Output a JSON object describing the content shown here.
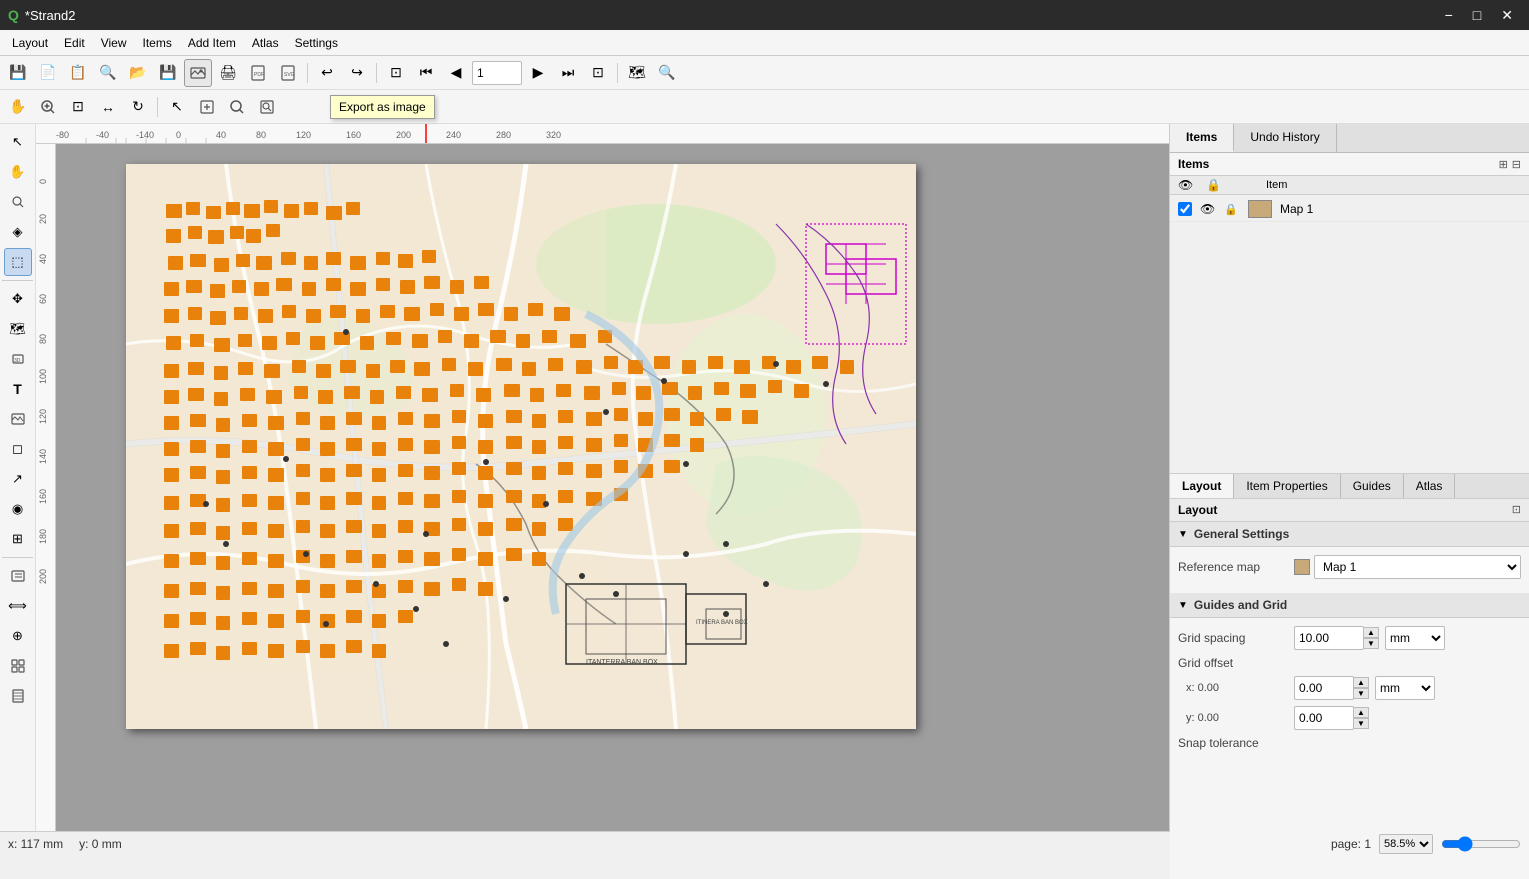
{
  "app": {
    "title": "*Strand2",
    "logo": "Q"
  },
  "titlebar": {
    "minimize": "−",
    "maximize": "□",
    "close": "✕"
  },
  "menubar": {
    "items": [
      "Layout",
      "Edit",
      "View",
      "Items",
      "Add Item",
      "Atlas",
      "Settings"
    ]
  },
  "toolbar1": {
    "buttons": [
      {
        "name": "save",
        "icon": "💾",
        "title": "Save"
      },
      {
        "name": "new",
        "icon": "📄",
        "title": "New"
      },
      {
        "name": "open-templates",
        "icon": "📋",
        "title": "Open Templates"
      },
      {
        "name": "duplicate",
        "icon": "🔍",
        "title": "Duplicate"
      },
      {
        "name": "open",
        "icon": "📂",
        "title": "Open"
      },
      {
        "name": "save2",
        "icon": "💾",
        "title": "Save"
      },
      {
        "name": "export-img",
        "icon": "🖼",
        "title": "Export as image"
      },
      {
        "name": "print",
        "icon": "🖨",
        "title": "Print"
      },
      {
        "name": "export-pdf",
        "icon": "📄",
        "title": "Export PDF"
      },
      {
        "name": "export-svg",
        "icon": "📐",
        "title": "Export SVG"
      },
      {
        "name": "undo",
        "icon": "↩",
        "title": "Undo"
      },
      {
        "name": "redo",
        "icon": "↪",
        "title": "Redo"
      }
    ],
    "page_input": "1",
    "nav_buttons": [
      "prev-page",
      "first-page",
      "prev",
      "next",
      "last-page",
      "next-page"
    ],
    "atlas_btn": "🗺",
    "zoom_btn": "🔍"
  },
  "toolbar2": {
    "buttons": [
      {
        "name": "pan",
        "icon": "✋",
        "title": "Pan"
      },
      {
        "name": "zoom-in",
        "icon": "🔍",
        "title": "Zoom In"
      },
      {
        "name": "zoom-full",
        "icon": "⊡",
        "title": "Zoom Full"
      },
      {
        "name": "zoom-width",
        "icon": "↔",
        "title": "Zoom Width"
      },
      {
        "name": "refresh",
        "icon": "↻",
        "title": "Refresh"
      },
      {
        "name": "select",
        "icon": "↖",
        "title": "Select"
      },
      {
        "name": "move-content",
        "icon": "⊕",
        "title": "Move Content"
      },
      {
        "name": "zoom-canvas",
        "icon": "🔎",
        "title": "Zoom Canvas"
      },
      {
        "name": "zoom-page",
        "icon": "🔎",
        "title": "Zoom Page"
      }
    ]
  },
  "tooltip": {
    "text": "Export as image"
  },
  "left_toolbar": {
    "buttons": [
      {
        "name": "select-tool",
        "icon": "↖",
        "active": false
      },
      {
        "name": "pan-tool",
        "icon": "✋",
        "active": false
      },
      {
        "name": "zoom-tool",
        "icon": "🔍",
        "active": false
      },
      {
        "name": "edit-nodes",
        "icon": "◈",
        "active": false
      },
      {
        "name": "select-area",
        "icon": "⬚",
        "active": true
      },
      {
        "name": "move-item",
        "icon": "✥",
        "active": false
      },
      {
        "name": "add-map",
        "icon": "🗺",
        "active": false
      },
      {
        "name": "add-label",
        "icon": "T",
        "active": false
      },
      {
        "name": "add-image",
        "icon": "🖼",
        "active": false
      },
      {
        "name": "add-shape",
        "icon": "◻",
        "active": false
      },
      {
        "name": "add-arrow",
        "icon": "↗",
        "active": false
      },
      {
        "name": "add-node",
        "icon": "◉",
        "active": false
      },
      {
        "name": "add-html",
        "icon": "⊞",
        "active": false
      },
      {
        "name": "add-legend",
        "icon": "≡",
        "active": false
      },
      {
        "name": "add-scalebar",
        "icon": "⟺",
        "active": false
      },
      {
        "name": "add-north",
        "icon": "⊕",
        "active": false
      },
      {
        "name": "group",
        "icon": "⊡",
        "active": false
      },
      {
        "name": "atlas-tool",
        "icon": "🗺",
        "active": false
      }
    ]
  },
  "right_panel": {
    "top_tabs": [
      {
        "id": "items",
        "label": "Items",
        "active": true
      },
      {
        "id": "undo-history",
        "label": "Undo History",
        "active": false
      }
    ],
    "items_header": "Items",
    "items_columns": {
      "eye": "👁",
      "lock": "🔒",
      "item": "Item"
    },
    "items_list": [
      {
        "id": "map1",
        "checked": true,
        "visible": true,
        "locked": false,
        "name": "Map 1",
        "has_thumb": true
      }
    ]
  },
  "bottom_tabs": [
    {
      "id": "layout",
      "label": "Layout",
      "active": true
    },
    {
      "id": "item-properties",
      "label": "Item Properties",
      "active": false
    },
    {
      "id": "guides",
      "label": "Guides",
      "active": false
    },
    {
      "id": "atlas",
      "label": "Atlas",
      "active": false
    }
  ],
  "layout_panel": {
    "section_title": "Layout",
    "general_settings": {
      "title": "General Settings",
      "reference_map_label": "Reference map",
      "reference_map_value": "Map 1"
    },
    "guides_grid": {
      "title": "Guides and Grid",
      "grid_spacing_label": "Grid spacing",
      "grid_spacing_value": "10.00",
      "grid_spacing_unit": "mm",
      "grid_offset_label": "Grid offset",
      "grid_offset_x_label": "x: 0.00",
      "grid_offset_y_label": "y: 0.00",
      "grid_offset_unit": "mm",
      "snap_tolerance_label": "Snap tolerance"
    }
  },
  "statusbar": {
    "coords": "x: 117 mm",
    "y_coords": "y: 0 mm",
    "page": "page: 1",
    "zoom": "58.5%"
  },
  "ruler": {
    "top_marks": [
      "-80",
      "-40",
      "-140",
      "0",
      "40",
      "80",
      "120",
      "160",
      "200",
      "240",
      "280",
      "320"
    ],
    "left_marks": [
      "0",
      "20",
      "40",
      "60",
      "80",
      "100",
      "120",
      "140",
      "160",
      "180",
      "200"
    ]
  }
}
